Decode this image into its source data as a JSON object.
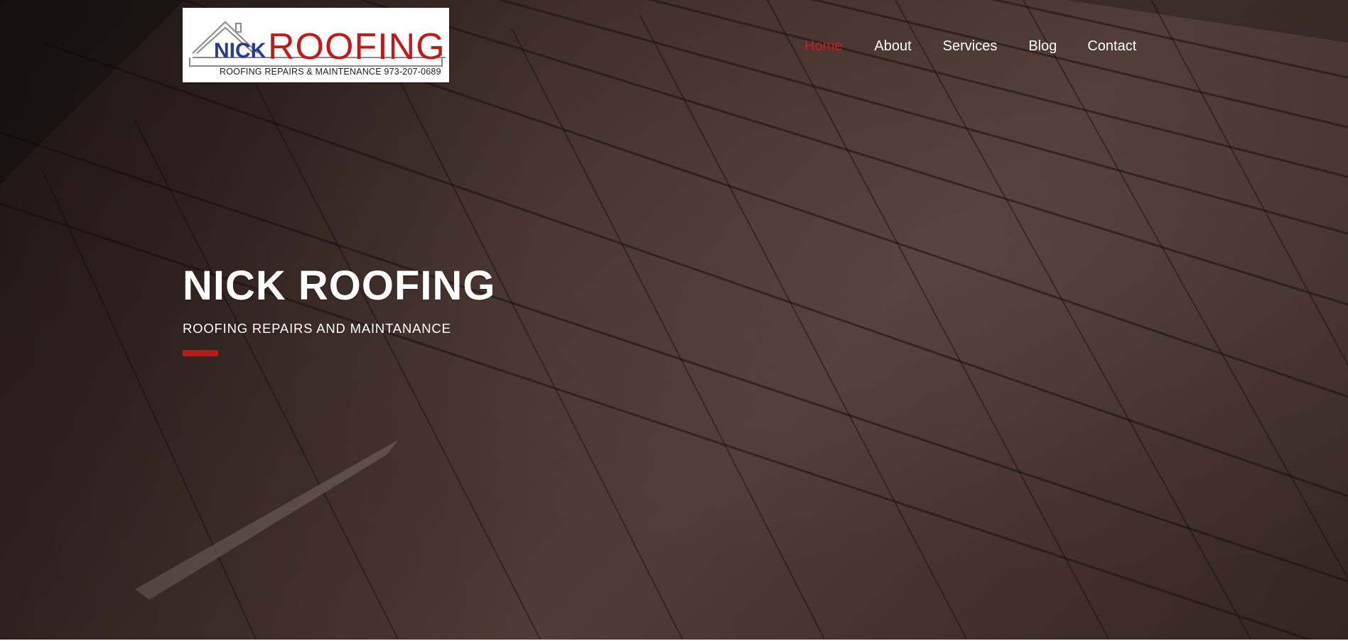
{
  "header": {
    "logo": {
      "brand_first": "NICK",
      "brand_second": "ROOFING",
      "tagline": "ROOFING REPAIRS & MAINTENANCE 973-207-0689",
      "colors": {
        "nick": "#2a3a8c",
        "roofing": "#c01a1a"
      }
    },
    "nav": {
      "items": [
        {
          "label": "Home",
          "active": true
        },
        {
          "label": "About",
          "active": false
        },
        {
          "label": "Services",
          "active": false
        },
        {
          "label": "Blog",
          "active": false
        },
        {
          "label": "Contact",
          "active": false
        }
      ]
    }
  },
  "hero": {
    "title": "NICK ROOFING",
    "subtitle": "ROOFING REPAIRS AND MAINTANANCE",
    "accent_color": "#b81a1a"
  },
  "theme": {
    "active_nav_color": "#c41f1f",
    "text_color": "#ffffff"
  }
}
